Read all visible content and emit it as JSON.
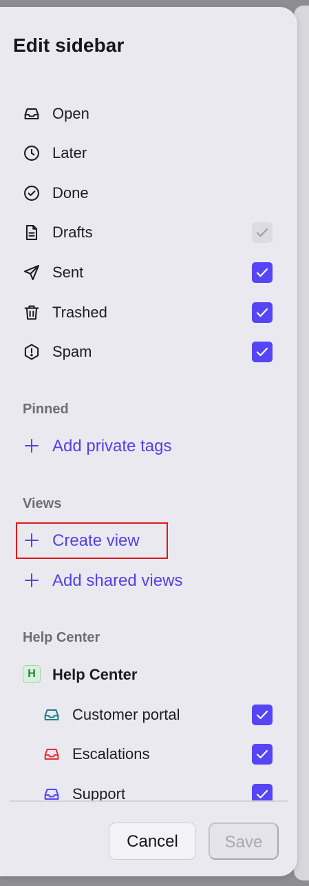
{
  "title": "Edit sidebar",
  "colors": {
    "accent": "#5745f5",
    "link": "#5142e6",
    "highlight": "#e01919"
  },
  "folders": [
    {
      "label": "Open",
      "icon": "inbox-icon",
      "checkbox": null
    },
    {
      "label": "Later",
      "icon": "clock-icon",
      "checkbox": null
    },
    {
      "label": "Done",
      "icon": "check-circle-icon",
      "checkbox": null
    },
    {
      "label": "Drafts",
      "icon": "document-icon",
      "checkbox": "disabled-checked"
    },
    {
      "label": "Sent",
      "icon": "send-icon",
      "checkbox": "checked"
    },
    {
      "label": "Trashed",
      "icon": "trash-icon",
      "checkbox": "checked"
    },
    {
      "label": "Spam",
      "icon": "spam-icon",
      "checkbox": "checked"
    }
  ],
  "pinned": {
    "header": "Pinned",
    "add_label": "Add private tags"
  },
  "views": {
    "header": "Views",
    "create_label": "Create view",
    "add_shared_label": "Add shared views"
  },
  "help_center": {
    "header": "Help Center",
    "badge": "H",
    "title": "Help Center",
    "items": [
      {
        "label": "Customer portal",
        "icon": "inbox-icon",
        "color": "#1f7f8c",
        "checked": true
      },
      {
        "label": "Escalations",
        "icon": "inbox-icon",
        "color": "#e5323b",
        "checked": true
      },
      {
        "label": "Support",
        "icon": "inbox-icon",
        "color": "#5745f5",
        "checked": true
      }
    ]
  },
  "footer": {
    "cancel_label": "Cancel",
    "save_label": "Save"
  }
}
